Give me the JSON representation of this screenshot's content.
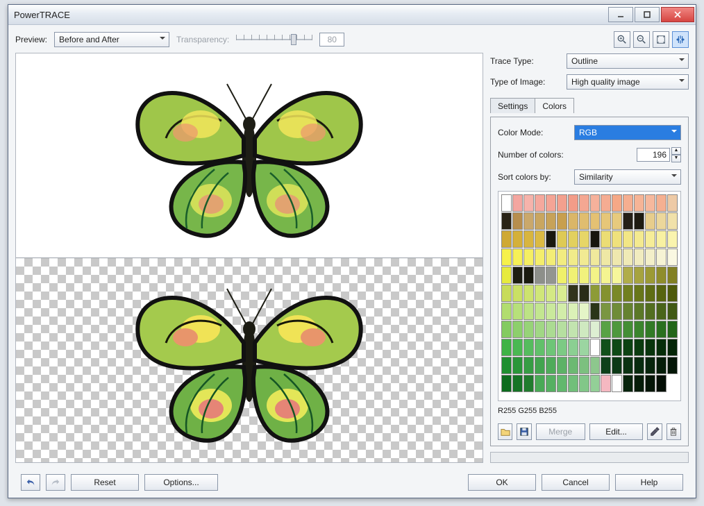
{
  "window": {
    "title": "PowerTRACE"
  },
  "toolbar": {
    "preview_label": "Preview:",
    "preview_mode": "Before and After",
    "transparency_label": "Transparency:",
    "transparency_value": "80"
  },
  "zoom_tools": {
    "zoom_in": "zoom-in",
    "zoom_out": "zoom-out",
    "fit": "fit",
    "pan": "pan"
  },
  "right": {
    "trace_type_label": "Trace Type:",
    "trace_type_value": "Outline",
    "image_type_label": "Type of Image:",
    "image_type_value": "High quality image",
    "tabs": {
      "settings": "Settings",
      "colors": "Colors",
      "active": "colors"
    },
    "color_mode_label": "Color Mode:",
    "color_mode_value": "RGB",
    "num_colors_label": "Number of colors:",
    "num_colors_value": "196",
    "sort_label": "Sort colors by:",
    "sort_value": "Similarity",
    "rgb_readout": "R255 G255 B255",
    "buttons": {
      "merge": "Merge",
      "edit": "Edit..."
    }
  },
  "footer": {
    "reset": "Reset",
    "options": "Options...",
    "ok": "OK",
    "cancel": "Cancel",
    "help": "Help"
  },
  "palette_colors": [
    "#ffffff",
    "#f4a6a0",
    "#f6b3ab",
    "#f5a89d",
    "#f4a495",
    "#f3a08e",
    "#f39c88",
    "#f4a792",
    "#f6b19b",
    "#f5ac92",
    "#f5a886",
    "#f5ae90",
    "#f6b496",
    "#f6b89d",
    "#f5b091",
    "#eecaa6",
    "#2a2416",
    "#b78e4e",
    "#caa86b",
    "#c9a660",
    "#c7a258",
    "#c89f4e",
    "#dab668",
    "#e0bd6f",
    "#e4c173",
    "#e6c678",
    "#e7ca7d",
    "#252018",
    "#1e1b12",
    "#e7cd8c",
    "#ecd79b",
    "#f1e1aa",
    "#cfa934",
    "#d4b03a",
    "#d8b53f",
    "#dbba43",
    "#1a1910",
    "#deca55",
    "#e2d05e",
    "#e7d667",
    "#17160d",
    "#ecdd74",
    "#efe17c",
    "#f2e685",
    "#f4ea8f",
    "#f6ed98",
    "#f8f1a2",
    "#faf4ae",
    "#f6f14a",
    "#f6f057",
    "#f5ef62",
    "#f4ee6c",
    "#f3ed76",
    "#f2ec80",
    "#f1eb8a",
    "#f1ea93",
    "#f0e99c",
    "#efe8a5",
    "#efe8ae",
    "#f0eab6",
    "#f1ecbf",
    "#f3efc9",
    "#f6f3d4",
    "#faf8e2",
    "#e7eb3e",
    "#1d1d12",
    "#1a1a0f",
    "#8d8f8a",
    "#939590",
    "#eff06a",
    "#f0f174",
    "#f1f27d",
    "#f3f387",
    "#f4f491",
    "#f6f69b",
    "#b0ad4a",
    "#a6a33f",
    "#9c9a35",
    "#8f8d2c",
    "#828023",
    "#c8dc59",
    "#cae064",
    "#cde36e",
    "#d0e679",
    "#d4e985",
    "#d9ec91",
    "#32331c",
    "#2a2c17",
    "#8d9b37",
    "#84922f",
    "#7a8927",
    "#717f20",
    "#68761a",
    "#5f6d14",
    "#57640f",
    "#4f5b0b",
    "#b2dd6f",
    "#b7e07a",
    "#bde385",
    "#c3e690",
    "#cae99c",
    "#d2eda9",
    "#dbf1b7",
    "#e5f5c7",
    "#2b3518",
    "#7a9641",
    "#6f8c38",
    "#65822f",
    "#5b7827",
    "#526e20",
    "#49641a",
    "#415a14",
    "#83cb60",
    "#8dcf6c",
    "#97d378",
    "#a1d785",
    "#abdb92",
    "#b6dfa0",
    "#c2e4af",
    "#cfe9c0",
    "#ddefd2",
    "#58a245",
    "#4e983d",
    "#448e35",
    "#3b842d",
    "#327a26",
    "#2a701f",
    "#236619",
    "#3fb346",
    "#4ab852",
    "#55bc5e",
    "#61c06a",
    "#6ec577",
    "#7cca84",
    "#8bcf92",
    "#9bd5a1",
    "#add cb2",
    "#11501a",
    "#0e4916",
    "#0c4212",
    "#0a3b0f",
    "#08340c",
    "#062d09",
    "#052607",
    "#1e8f2f",
    "#2a9639",
    "#369d44",
    "#42a44f",
    "#4fab5a",
    "#5db266",
    "#6cb972",
    "#7cc07f",
    "#8dc78d",
    "#0e401a",
    "#0c3916",
    "#0a3212",
    "#082b0f",
    "#07240c",
    "#051d09",
    "#041607",
    "#0c6c1d",
    "#167425",
    "#217c2e",
    "#49a956",
    "#55b061",
    "#62b86d",
    "#71bf7a",
    "#81c788",
    "#93cf97",
    "#f5b8c1",
    "#ffffff",
    "#06230b",
    "#051c09",
    "#041507",
    "#030e05",
    ""
  ]
}
